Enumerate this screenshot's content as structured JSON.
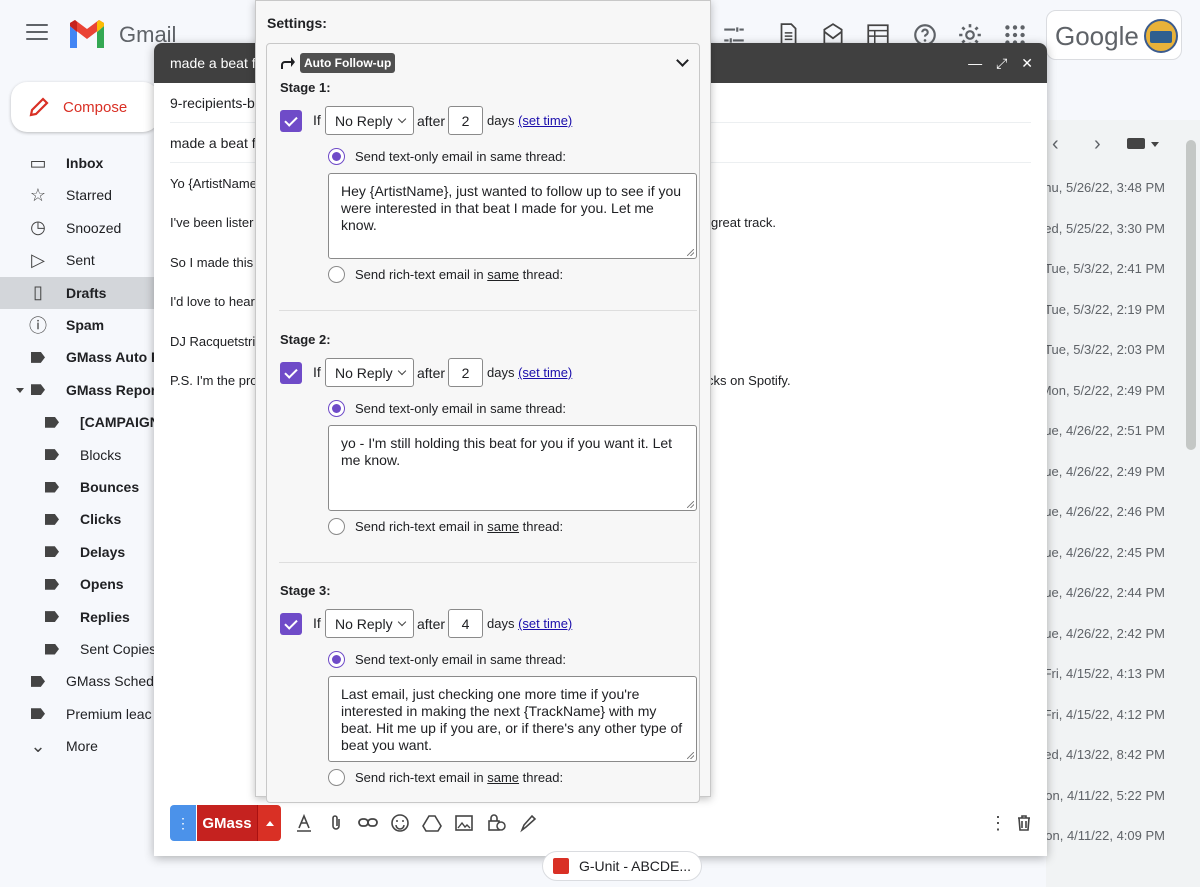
{
  "app": {
    "name": "Gmail",
    "search_brand": "Google"
  },
  "sidebar": {
    "compose_label": "Compose",
    "items": [
      {
        "label": "Inbox",
        "icon": "inbox-icon",
        "bold": true
      },
      {
        "label": "Starred",
        "icon": "star-icon"
      },
      {
        "label": "Snoozed",
        "icon": "clock-icon"
      },
      {
        "label": "Sent",
        "icon": "send-icon"
      },
      {
        "label": "Drafts",
        "icon": "file-icon",
        "bold": true,
        "active": true
      },
      {
        "label": "Spam",
        "icon": "spam-icon",
        "bold": true
      },
      {
        "label": "GMass Auto F",
        "icon": "label-icon",
        "bold": true
      },
      {
        "label": "GMass Repor",
        "icon": "label-icon",
        "bold": true,
        "expanded": true
      },
      {
        "label": "[CAMPAIGN",
        "icon": "label-icon",
        "bold": true,
        "sub": true
      },
      {
        "label": "Blocks",
        "icon": "label-icon",
        "sub": true
      },
      {
        "label": "Bounces",
        "icon": "label-icon",
        "bold": true,
        "sub": true
      },
      {
        "label": "Clicks",
        "icon": "label-icon",
        "bold": true,
        "sub": true
      },
      {
        "label": "Delays",
        "icon": "label-icon",
        "bold": true,
        "sub": true
      },
      {
        "label": "Opens",
        "icon": "label-icon",
        "bold": true,
        "sub": true
      },
      {
        "label": "Replies",
        "icon": "label-icon",
        "bold": true,
        "sub": true
      },
      {
        "label": "Sent Copies",
        "icon": "label-icon",
        "sub": true
      },
      {
        "label": "GMass Sched",
        "icon": "label-icon"
      },
      {
        "label": "Premium leac",
        "icon": "label-icon"
      },
      {
        "label": "More",
        "icon": "chevron-down-icon"
      }
    ]
  },
  "list_dates": [
    "hu, 5/26/22, 3:48 PM",
    "ed, 5/25/22, 3:30 PM",
    "Tue, 5/3/22, 2:41 PM",
    "Tue, 5/3/22, 2:19 PM",
    "Tue, 5/3/22, 2:03 PM",
    "Mon, 5/2/22, 2:49 PM",
    "ue, 4/26/22, 2:51 PM",
    "ue, 4/26/22, 2:49 PM",
    "ue, 4/26/22, 2:46 PM",
    "ue, 4/26/22, 2:45 PM",
    "ue, 4/26/22, 2:44 PM",
    "ue, 4/26/22, 2:42 PM",
    "Fri, 4/15/22, 4:13 PM",
    "Fri, 4/15/22, 4:12 PM",
    "ed, 4/13/22, 8:42 PM",
    "on, 4/11/22, 5:22 PM",
    "on, 4/11/22, 4:09 PM"
  ],
  "compose": {
    "title": "made a beat f",
    "to": "9-recipients-b",
    "subject": "made a beat f",
    "body": [
      "Yo {ArtistName",
      "I've been lister",
      "So I made this",
      "I'd love to hear",
      "DJ Racquetstri",
      "P.S. I'm the pro"
    ],
    "body_right": [
      {
        "line": 1,
        "text": "great track."
      },
      {
        "line": 5,
        "text": "cks on Spotify."
      }
    ],
    "send_label": "GMass",
    "attachment": "G-Unit - ABCDE..."
  },
  "settings": {
    "title": "Settings:",
    "section_label": "Auto Follow-up",
    "if_label": "If",
    "after_label": "after",
    "days_label": "days",
    "set_time_label": "(set time)",
    "text_only_label": "Send text-only email in same thread:",
    "rich_prefix": "Send rich-text email in ",
    "rich_same": "same",
    "rich_suffix": " thread:",
    "stages": [
      {
        "title": "Stage 1:",
        "condition": "No Reply",
        "days": "2",
        "message": "Hey {ArtistName}, just wanted to follow up to see if you were interested in that beat I made for you. Let me know."
      },
      {
        "title": "Stage 2:",
        "condition": "No Reply",
        "days": "2",
        "message": "yo - I'm still holding this beat for you if you want it. Let me know."
      },
      {
        "title": "Stage 3:",
        "condition": "No Reply",
        "days": "4",
        "message": "Last email, just checking one more time if you're interested in making the next {TrackName} with my beat. Hit me up if you are, or if there's any other type of beat you want."
      }
    ]
  },
  "colors": {
    "accent": "#6f4bc8",
    "send_red": "#c5221f",
    "title_bar": "#404040"
  }
}
